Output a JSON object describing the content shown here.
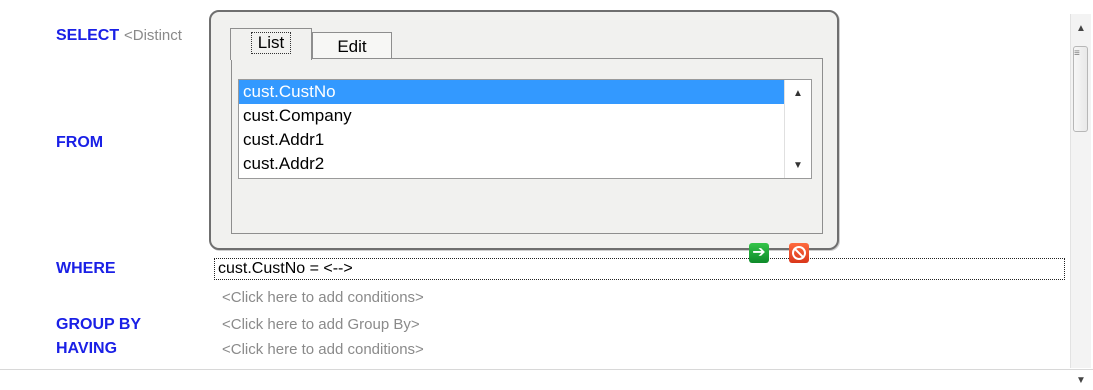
{
  "keywords": {
    "select": "SELECT",
    "from": "FROM",
    "where": "WHERE",
    "group_by": "GROUP BY",
    "having": "HAVING"
  },
  "select": {
    "distinct_hint": "<Distinct"
  },
  "where": {
    "condition": "cust.CustNo  =  <-->",
    "add_conditions": "<Click here to add conditions>"
  },
  "group_by": {
    "hint": "<Click here to add Group By>"
  },
  "having": {
    "hint": "<Click here to add conditions>"
  },
  "popup": {
    "tabs": [
      "List",
      "Edit"
    ],
    "active_tab": "List",
    "items": [
      "cust.CustNo",
      "cust.Company",
      "cust.Addr1",
      "cust.Addr2"
    ],
    "selected_item": "cust.CustNo",
    "ok_icon": "arrow-right-icon",
    "cancel_icon": "cancel-icon"
  },
  "colors": {
    "keyword": "#1a20e6",
    "selection": "#3399ff",
    "ok": "#1ca235",
    "cancel": "#f04a24"
  }
}
